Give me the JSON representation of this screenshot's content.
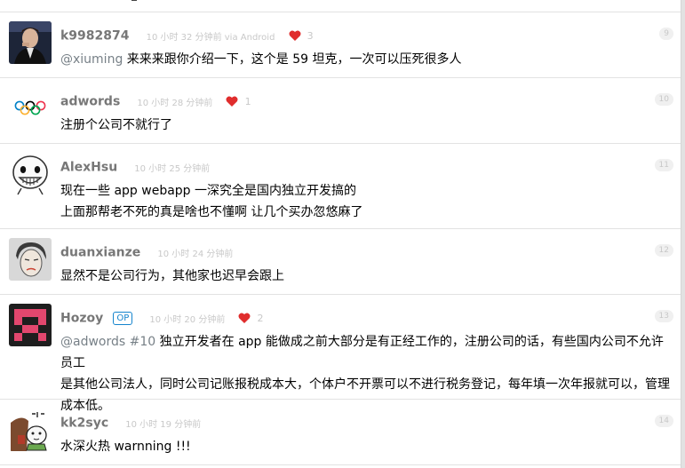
{
  "replies": [
    {
      "floor": "9",
      "username": "k9982874",
      "time": "10 小时 32 分钟前 via Android",
      "likes": "3",
      "mention": "@xiuming",
      "text": " 来来来跟你介绍一下，这个是 59 坦克，一次可以压死很多人"
    },
    {
      "floor": "10",
      "username": "adwords",
      "time": "10 小时 28 分钟前",
      "likes": "1",
      "text": "注册个公司不就行了"
    },
    {
      "floor": "11",
      "username": "AlexHsu",
      "time": "10 小时 25 分钟前",
      "lines": [
        "现在一些 app webapp 一深究全是国内独立开发搞的",
        "上面那帮老不死的真是啥也不懂啊 让几个买办忽悠麻了"
      ]
    },
    {
      "floor": "12",
      "username": "duanxianze",
      "time": "10 小时 24 分钟前",
      "text": "显然不是公司行为，其他家也迟早会跟上"
    },
    {
      "floor": "13",
      "username": "Hozoy",
      "badge": "OP",
      "time": "10 小时 20 分钟前",
      "likes": "2",
      "mention": "@adwords",
      "ref": " #10",
      "lines": [
        " 独立开发者在 app 能做成之前大部分是有正经工作的，注册公司的话，有些国内公司不允许员工",
        "是其他公司法人，同时公司记账报税成本大，个体户不开票可以不进行税务登记，每年填一次年报就可以，管理",
        "成本低。"
      ]
    },
    {
      "floor": "14",
      "username": "kk2syc",
      "time": "10 小时 19 分钟前",
      "text": "水深火热 warnning !!!"
    }
  ],
  "colors": {
    "heart": "#e02d2d",
    "op": "#1484cd"
  },
  "icons": {
    "heart": "heart-icon"
  }
}
